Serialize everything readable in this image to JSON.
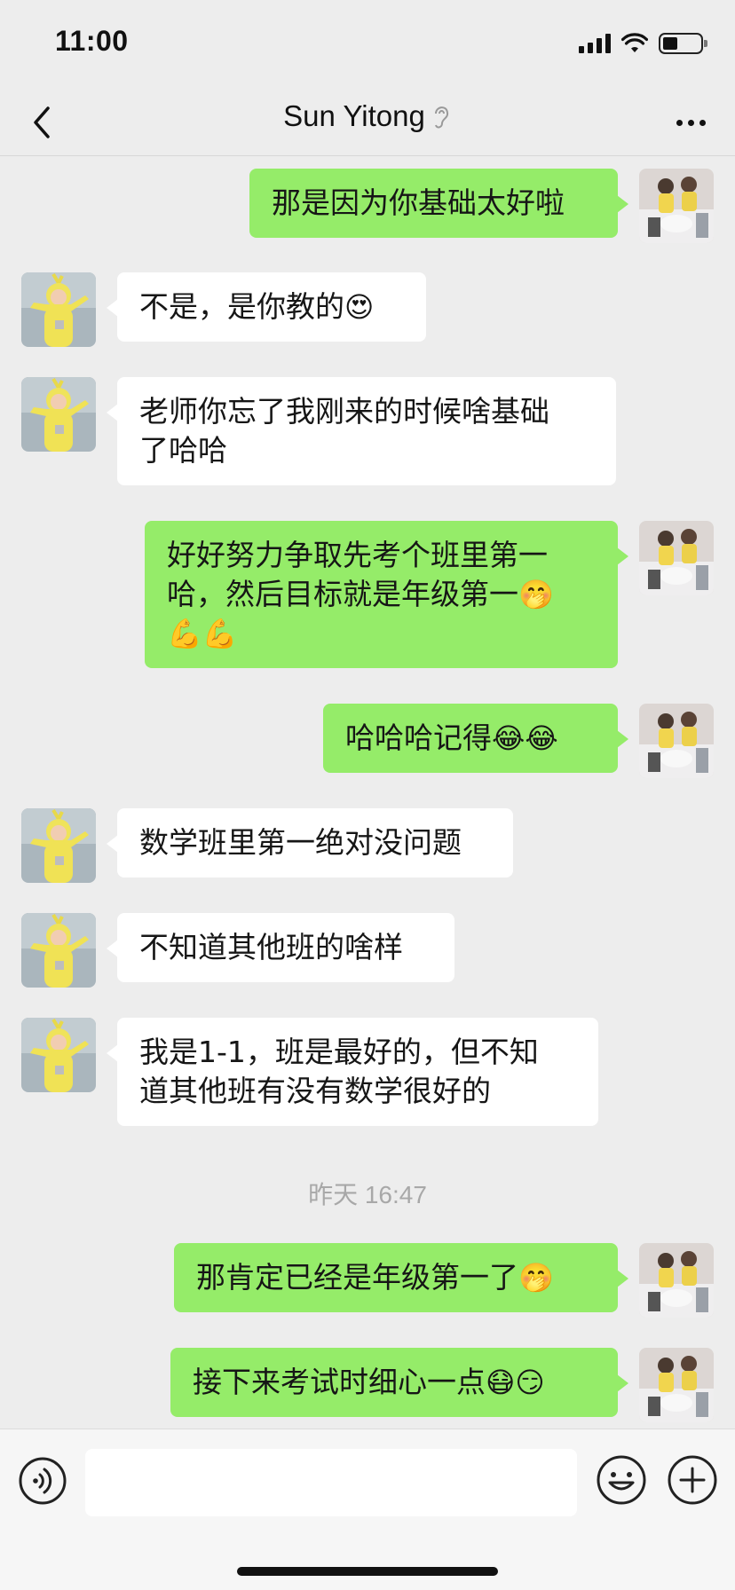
{
  "status_bar": {
    "time": "11:00"
  },
  "nav": {
    "title": "Sun Yitong"
  },
  "timestamp": "昨天 16:47",
  "messages": [
    {
      "side": "right",
      "lines": [
        "那是因为你基础太好啦"
      ]
    },
    {
      "side": "left",
      "lines": [
        "不是，是你教的"
      ],
      "emoji": "😍"
    },
    {
      "side": "left",
      "lines": [
        "老师你忘了我刚来的时候啥基础",
        "了哈哈"
      ]
    },
    {
      "side": "right",
      "lines": [
        "好好努力争取先考个班里第一",
        "哈，然后目标就是年级第一"
      ],
      "emoji_inline": "🤭",
      "emoji_line": "💪💪"
    },
    {
      "side": "right",
      "lines": [
        "哈哈哈记得"
      ],
      "emoji": "😂😂"
    },
    {
      "side": "left",
      "lines": [
        "数学班里第一绝对没问题"
      ]
    },
    {
      "side": "left",
      "lines": [
        "不知道其他班的啥样"
      ]
    },
    {
      "side": "left",
      "lines": [
        "我是1-1，班是最好的，但不知",
        "道其他班有没有数学很好的"
      ]
    },
    {
      "side": "right",
      "lines": [
        "那肯定已经是年级第一了"
      ],
      "emoji": "🤭"
    },
    {
      "side": "right",
      "lines": [
        "接下来考试时细心一点"
      ],
      "emoji": "😷😏"
    }
  ],
  "colors": {
    "right_bubble": "#95ec69",
    "left_bubble": "#ffffff",
    "background": "#ededed"
  },
  "icons": [
    "back-icon",
    "ear-icon",
    "more-icon",
    "voice-icon",
    "emoji-icon",
    "plus-icon"
  ]
}
